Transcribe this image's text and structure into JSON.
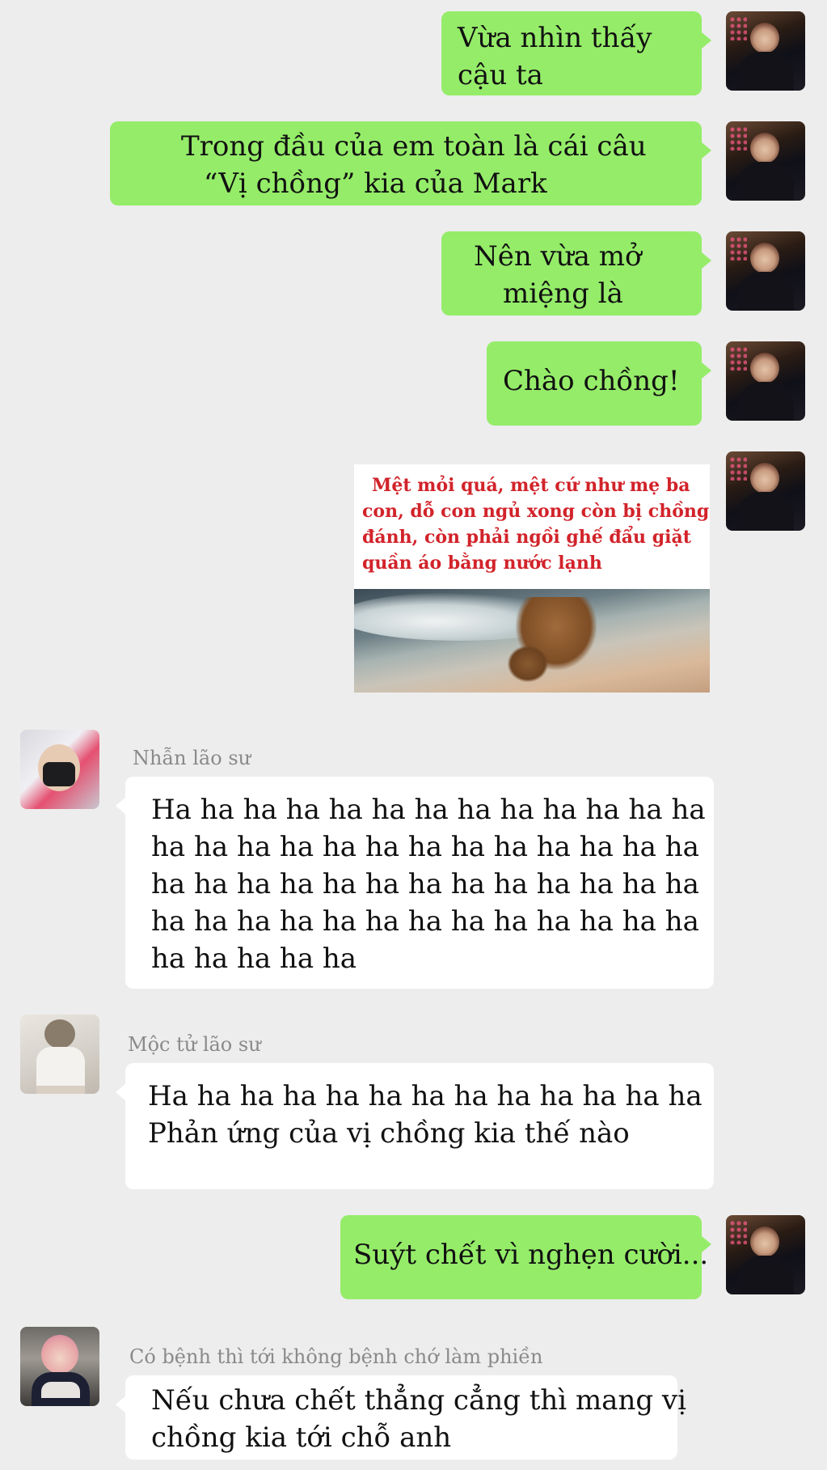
{
  "colors": {
    "background": "#ededed",
    "outgoing_bubble": "#95ec69",
    "incoming_bubble": "#ffffff",
    "meme_caption": "#d2232a"
  },
  "messages": [
    {
      "side": "out",
      "lines": [
        "Vừa nhìn thấy",
        "cậu ta"
      ]
    },
    {
      "side": "out",
      "lines": [
        "Trong đầu của em toàn là cái câu",
        "“Vị chồng” kia của Mark"
      ]
    },
    {
      "side": "out",
      "lines": [
        "Nên vừa mở",
        "miệng là"
      ]
    },
    {
      "side": "out",
      "lines": [
        "Chào chồng!"
      ]
    },
    {
      "side": "out",
      "type": "image",
      "caption_lines": [
        "Mệt mỏi quá, mệt cứ như mẹ ba",
        "con, dỗ con ngủ xong còn bị chồng",
        "đánh, còn phải ngồi ghế đẩu giặt",
        "quần áo bằng nước lạnh"
      ],
      "image_icon": "dog-on-beach-image"
    },
    {
      "side": "in",
      "sender": "Nhẫn lão sư",
      "lines": [
        "Ha ha ha ha ha ha ha ha ha ha ha ha ha",
        "ha ha ha ha ha ha ha ha ha ha ha ha ha",
        "ha ha ha ha ha ha ha ha ha ha ha ha ha",
        "ha ha ha ha ha ha ha ha ha ha ha ha ha",
        "ha ha ha ha ha"
      ]
    },
    {
      "side": "in",
      "sender": "Mộc tử lão sư",
      "lines": [
        "Ha ha ha ha ha ha ha ha ha ha ha ha ha",
        "Phản ứng của vị chồng kia thế nào"
      ]
    },
    {
      "side": "out",
      "lines": [
        "Suýt chết vì nghẹn cười..."
      ]
    },
    {
      "side": "in",
      "sender": "Có bệnh thì tới không bệnh chớ làm phiền",
      "lines": [
        "Nếu chưa chết thẳng cẳng thì mang vị",
        "chồng kia tới chỗ anh"
      ]
    }
  ]
}
